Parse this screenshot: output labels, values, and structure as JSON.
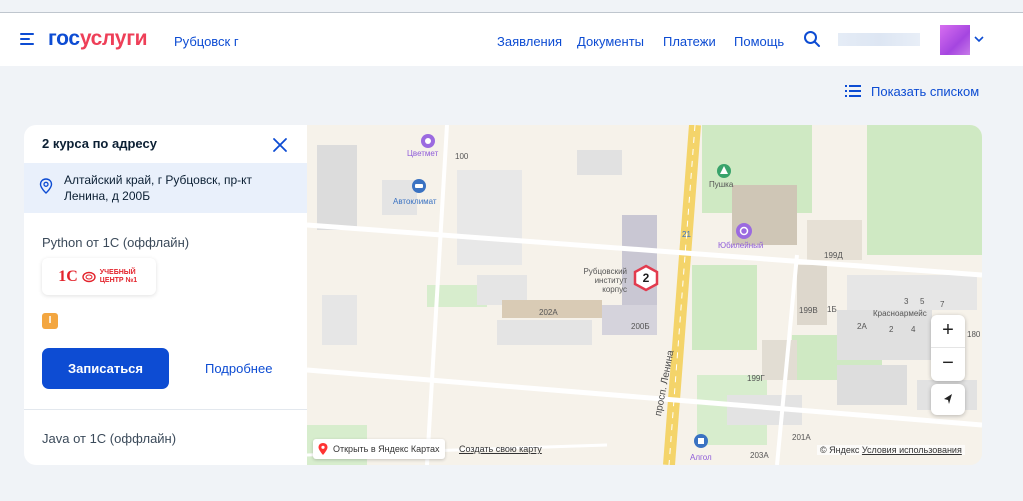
{
  "header": {
    "logo_part1": "гос",
    "logo_part2": "услуги",
    "city": "Рубцовск г",
    "nav": [
      "Заявления",
      "Документы",
      "Платежи",
      "Помощь"
    ]
  },
  "list_toggle": {
    "label": "Показать списком"
  },
  "panel": {
    "heading": "2 курса по адресу",
    "address": "Алтайский край, г Рубцовск, пр-кт Ленина, д 200Б",
    "courses": [
      {
        "title": "Python от 1С (оффлайн)",
        "partner_logo": "1С",
        "partner_text": "УЧЕБНЫЙ ЦЕНТР №1",
        "level_badge": "I",
        "enroll_label": "Записаться",
        "more_label": "Подробнее"
      },
      {
        "title": "Java от 1С (оффлайн)"
      }
    ]
  },
  "map": {
    "cluster_count": "2",
    "labels": {
      "cvetmet": "Цветмет",
      "n100": "100",
      "avtoklimat": "Автоклимат",
      "pushka": "Пушка",
      "yubileiny": "Юбилейный",
      "n199d": "199Д",
      "rubtsovsk_inst": "Рубцовский институт корпус",
      "n21": "21",
      "n202a": "202А",
      "n200b": "200Б",
      "n199v": "199В",
      "n1b": "1Б",
      "n3": "3",
      "n5": "5",
      "n7": "7",
      "n2a": "2А",
      "n2": "2",
      "n4": "4",
      "krasnoarm": "Красноармейс",
      "n180": "180",
      "n199g": "199Г",
      "n201a": "201А",
      "n203a": "203А",
      "algol": "Алгол",
      "street": "просп. Ленина"
    },
    "zoom_in": "+",
    "zoom_out": "−",
    "open_yandex": "Открыть в Яндекс Картах",
    "create_map": "Создать свою карту",
    "copyright": "© Яндекс",
    "terms": "Условия использования"
  },
  "colors": {
    "brand_blue": "#0d4cd3",
    "brand_red": "#ee3f58",
    "cluster_red": "#e23b4e"
  }
}
